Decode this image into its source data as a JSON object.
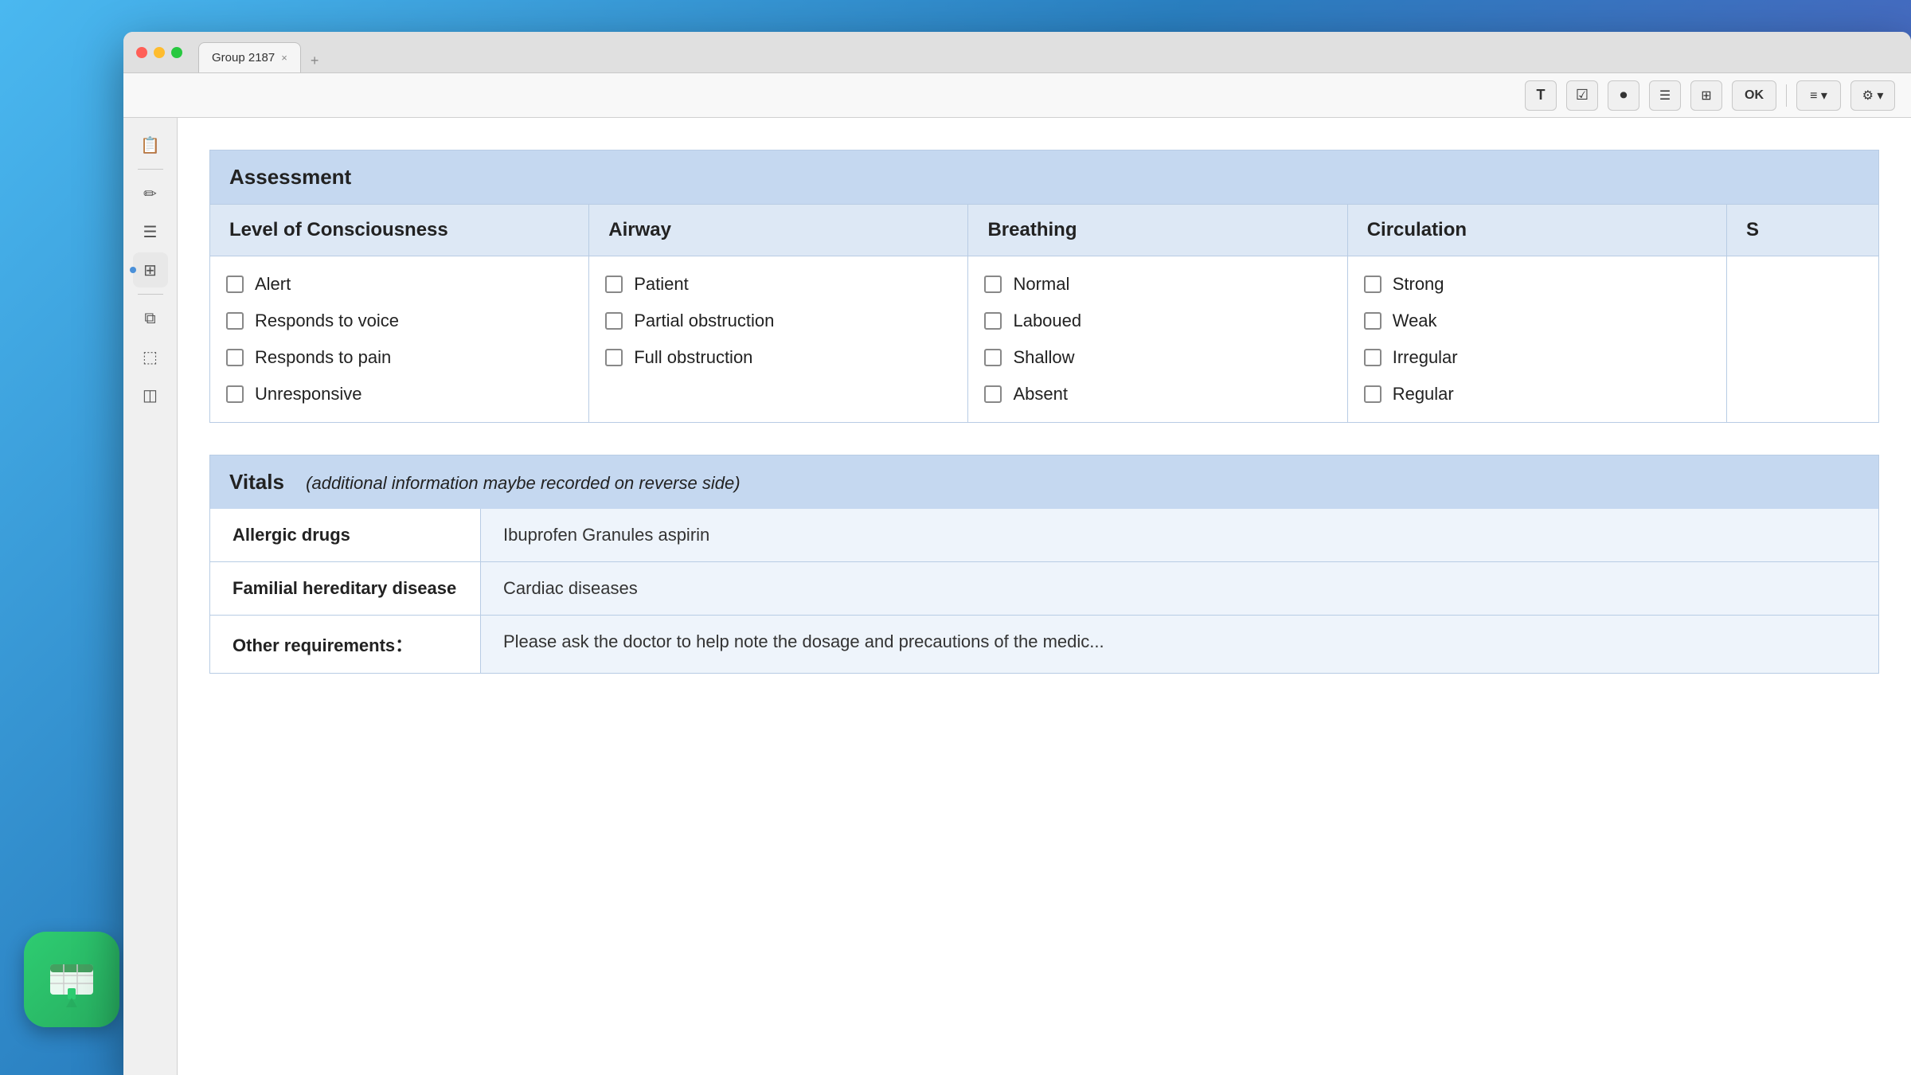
{
  "window": {
    "title": "Group 2187",
    "tab_close": "×",
    "tab_add": "+"
  },
  "traffic_lights": {
    "close": "close",
    "minimize": "minimize",
    "maximize": "maximize"
  },
  "toolbar": {
    "buttons": [
      {
        "id": "text-tool",
        "label": "T",
        "icon": "text-icon"
      },
      {
        "id": "checkbox-tool",
        "label": "✓",
        "icon": "checkbox-icon"
      },
      {
        "id": "record-tool",
        "label": "⏺",
        "icon": "record-icon"
      },
      {
        "id": "list-tool",
        "label": "≡",
        "icon": "list-icon"
      },
      {
        "id": "columns-tool",
        "label": "⊞",
        "icon": "columns-icon"
      },
      {
        "id": "ok-tool",
        "label": "OK",
        "icon": "ok-icon"
      },
      {
        "id": "align-tool",
        "label": "≡▾",
        "icon": "align-icon"
      },
      {
        "id": "settings-tool",
        "label": "⚙",
        "icon": "settings-icon"
      }
    ]
  },
  "sidebar": {
    "icons": [
      {
        "id": "book",
        "symbol": "📋",
        "label": "book-icon"
      },
      {
        "id": "pen",
        "symbol": "✏",
        "label": "pen-icon"
      },
      {
        "id": "list",
        "symbol": "☰",
        "label": "list-icon"
      },
      {
        "id": "table",
        "symbol": "⊞",
        "label": "table-icon",
        "active": true,
        "dot": true
      },
      {
        "id": "copy",
        "symbol": "⧉",
        "label": "copy-icon"
      },
      {
        "id": "frames",
        "symbol": "⬚",
        "label": "frames-icon"
      },
      {
        "id": "layers",
        "symbol": "◫",
        "label": "layers-icon"
      }
    ]
  },
  "assessment": {
    "section_title": "Assessment",
    "columns": [
      {
        "id": "level-of-consciousness",
        "title": "Level of Consciousness",
        "items": [
          "Alert",
          "Responds to voice",
          "Responds to pain",
          "Unresponsive"
        ]
      },
      {
        "id": "airway",
        "title": "Airway",
        "items": [
          "Patient",
          "Partial obstruction",
          "Full obstruction"
        ]
      },
      {
        "id": "breathing",
        "title": "Breathing",
        "items": [
          "Normal",
          "Laboued",
          "Shallow",
          "Absent"
        ]
      },
      {
        "id": "circulation",
        "title": "Circulation",
        "items": [
          "Strong",
          "Weak",
          "Irregular",
          "Regular"
        ]
      },
      {
        "id": "s-column",
        "title": "S",
        "items": []
      }
    ]
  },
  "vitals": {
    "section_title": "Vitals",
    "section_note": "(additional information maybe recorded on reverse side)",
    "rows": [
      {
        "id": "allergic-drugs",
        "label": "Allergic drugs",
        "value": "Ibuprofen Granules  aspirin"
      },
      {
        "id": "familial-hereditary-disease",
        "label": "Familial hereditary disease",
        "value": "Cardiac diseases"
      },
      {
        "id": "other-requirements",
        "label": "Other requirements：",
        "value": "Please ask the doctor to help note the dosage and precautions of the medic..."
      }
    ]
  },
  "app_icon": {
    "label": "TableFlip"
  }
}
